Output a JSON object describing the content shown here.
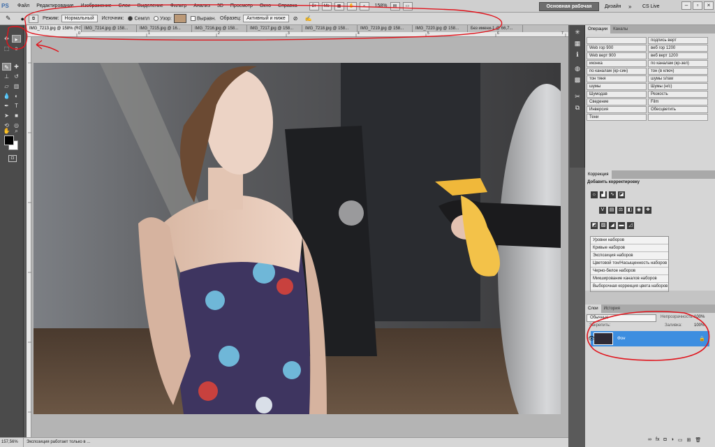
{
  "menubar": {
    "logo": "PS",
    "items": [
      "Файл",
      "Редактирование",
      "Изображение",
      "Слои",
      "Выделение",
      "Фильтр",
      "Анализ",
      "3D",
      "Просмотр",
      "Окно",
      "Справка"
    ],
    "zoom": "158%",
    "workspace_active": "Основная рабочая среда",
    "workspace_alt": "Дизайн",
    "workspace_more": "»",
    "cs_live": "CS Live"
  },
  "options": {
    "mode_label": "Режим:",
    "mode_value": "Нормальный",
    "source_label": "Источник:",
    "source_value": "Семпл",
    "pattern_label": "Узор:",
    "aligned_label": "Выравн.",
    "sample_label": "Образец:",
    "sample_value": "Активный и ниже"
  },
  "tabs": [
    "IMG_7213.jpg @ 158% (RGB/8) *",
    "IMG_7214.jpg @ 158...",
    "IMG_7215.jpg @ 16...",
    "IMG_7216.jpg @ 158...",
    "IMG_7217.jpg @ 158...",
    "IMG_7218.jpg @ 158...",
    "IMG_7219.jpg @ 158...",
    "IMG_7220.jpg @ 158...",
    "Без имени-1 @ 66,7..."
  ],
  "ruler_marks": [
    "0",
    "1",
    "2",
    "3",
    "4",
    "5",
    "6",
    "7"
  ],
  "panels": {
    "actions_tabs": [
      "Операции",
      "Каналы"
    ],
    "actions": [
      [
        "",
        "подпись верт"
      ],
      [
        "Web гор 900",
        "веб гор 1200"
      ],
      [
        "Web верт 900",
        "веб верт 1200"
      ],
      [
        "иконка",
        "по каналам (кр-зел)"
      ],
      [
        "по каналам (кр-син)",
        "тон (в ключ)"
      ],
      [
        "тон тяня",
        "шумы s/raw"
      ],
      [
        "шумы",
        "Шумы (н/с)"
      ],
      [
        "Шумодав",
        "Резкость"
      ],
      [
        "Сведение",
        "Film"
      ],
      [
        "Инверсия",
        "Обесцветить"
      ],
      [
        "Тени",
        ""
      ]
    ],
    "corrections_tab": "Коррекция",
    "corrections_title": "Добавить корректировку",
    "presets": [
      "Уровни наборов",
      "Кривые наборов",
      "Экспозиция наборов",
      "Цветовой тон/Насыщенность наборов",
      "Черно-белое наборов",
      "Микширование каналов наборов",
      "Выборочная коррекция цвета наборов"
    ],
    "layers_tabs": [
      "Слои",
      "История"
    ],
    "blend_mode": "Обычные",
    "opacity_label": "Непрозрачность:",
    "opacity_value": "100%",
    "lock_label": "Закрепить:",
    "fill_label": "Заливка:",
    "fill_value": "100%",
    "layer_name": "Фон"
  },
  "status": {
    "zoom": "157,56%",
    "info": "Экспозиция работает только в ..."
  }
}
